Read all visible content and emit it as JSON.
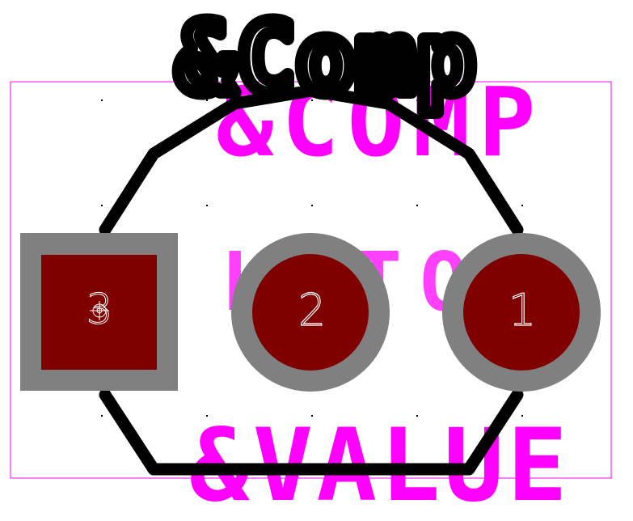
{
  "component": {
    "reference_label": "&Comp",
    "fab_reference_label": "&COMP",
    "fab_value_label": "&VALUE",
    "package_name": "L8TO2"
  },
  "pads": [
    {
      "number": "3",
      "shape": "square"
    },
    {
      "number": "2",
      "shape": "round"
    },
    {
      "number": "1",
      "shape": "round"
    }
  ],
  "colors": {
    "background": "#ffffff",
    "courtyard_outline": "#ff00ff",
    "fab_text": "#ff00ff",
    "silkscreen": "#000000",
    "copper_pad": "#800000",
    "solder_mask": "#808080",
    "pad_number_text": "#ffffff",
    "grid_dot": "#000000"
  }
}
